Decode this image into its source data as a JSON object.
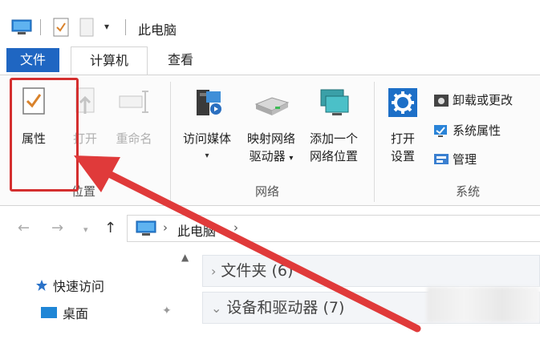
{
  "window": {
    "title": "此电脑"
  },
  "tabs": {
    "file": "文件",
    "computer": "计算机",
    "view": "查看"
  },
  "ribbon": {
    "location": {
      "label": "位置",
      "properties": "属性",
      "open": "打开",
      "rename": "重命名"
    },
    "network": {
      "label": "网络",
      "access_media": "访问媒体",
      "map_drive_line1": "映射网络",
      "map_drive_line2": "驱动器",
      "add_location_line1": "添加一个",
      "add_location_line2": "网络位置"
    },
    "system": {
      "label": "系统",
      "open_settings_line1": "打开",
      "open_settings_line2": "设置",
      "uninstall": "卸载或更改",
      "system_properties": "系统属性",
      "manage": "管理"
    }
  },
  "address": {
    "path": "此电脑"
  },
  "nav_pane": {
    "quick_access": "快速访问",
    "desktop": "桌面"
  },
  "content": {
    "folders": "文件夹 (6)",
    "devices": "设备和驱动器 (7)"
  },
  "colors": {
    "accent": "#1f66c2",
    "highlight": "#d42f2f"
  },
  "icons": [
    "computer-icon",
    "properties-icon",
    "new-folder-icon",
    "open-icon",
    "rename-icon",
    "media-icon",
    "network-drive-icon",
    "network-location-icon",
    "gear-icon",
    "uninstall-icon",
    "system-properties-icon",
    "manage-icon",
    "star-icon",
    "desktop-icon",
    "pin-icon"
  ]
}
